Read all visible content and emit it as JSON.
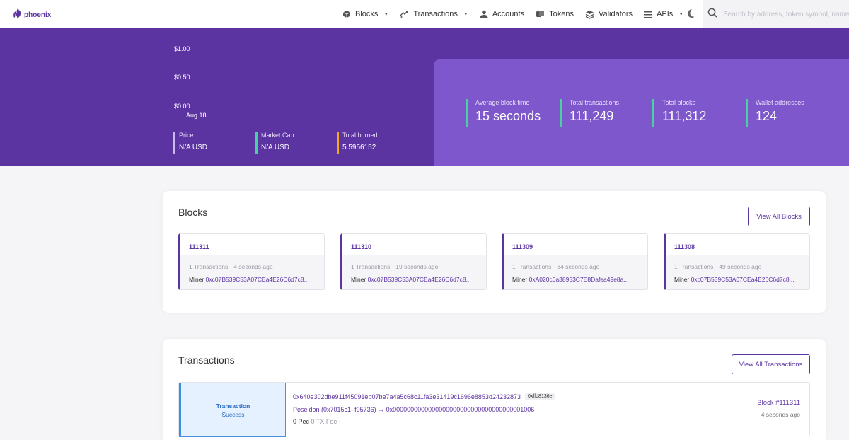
{
  "nav": {
    "logo_text": "phoenix",
    "items": [
      {
        "label": "Blocks",
        "icon": "cube-icon",
        "dropdown": true
      },
      {
        "label": "Transactions",
        "icon": "transfer-icon",
        "dropdown": true
      },
      {
        "label": "Accounts",
        "icon": "user-icon",
        "dropdown": false
      },
      {
        "label": "Tokens",
        "icon": "coins-icon",
        "dropdown": false
      },
      {
        "label": "Validators",
        "icon": "layers-icon",
        "dropdown": false
      },
      {
        "label": "APIs",
        "icon": "menu-icon",
        "dropdown": true
      }
    ],
    "search_placeholder": "Search by address, token symbol, name"
  },
  "hero": {
    "chart_ticks": [
      "$1.00",
      "$0.50",
      "$0.00"
    ],
    "chart_date": "Aug 18",
    "stats": [
      {
        "label": "Price",
        "value": "N/A USD"
      },
      {
        "label": "Market Cap",
        "value": "N/A USD"
      },
      {
        "label": "Total burned",
        "value": "5.5956152"
      }
    ],
    "panel_stats": [
      {
        "label": "Average block time",
        "value": "15 seconds"
      },
      {
        "label": "Total transactions",
        "value": "111,249"
      },
      {
        "label": "Total blocks",
        "value": "111,312"
      },
      {
        "label": "Wallet addresses",
        "value": "124"
      }
    ]
  },
  "blocks": {
    "title": "Blocks",
    "view_all": "View All Blocks",
    "items": [
      {
        "number": "111311",
        "tx_count": "1 Transactions",
        "age": "4 seconds ago",
        "miner_label": "Miner",
        "miner": "0xc07B539C53A07CEa4E26C6d7c8..."
      },
      {
        "number": "111310",
        "tx_count": "1 Transactions",
        "age": "19 seconds ago",
        "miner_label": "Miner",
        "miner": "0xc07B539C53A07CEa4E26C6d7c8..."
      },
      {
        "number": "111309",
        "tx_count": "1 Transactions",
        "age": "34 seconds ago",
        "miner_label": "Miner",
        "miner": "0xA020c0a38953C7E8Dafea49e8a..."
      },
      {
        "number": "111308",
        "tx_count": "1 Transactions",
        "age": "49 seconds ago",
        "miner_label": "Miner",
        "miner": "0xc07B539C53A07CEa4E26C6d7c8..."
      }
    ]
  },
  "transactions": {
    "title": "Transactions",
    "view_all": "View All Transactions",
    "items": [
      {
        "type": "Transaction",
        "status": "Success",
        "hash": "0x640e302dbe911f45091eb07be7a4a5c68c11fa3e31419c1696e8853d24232873",
        "method": "0xffd8136e",
        "route": "Poseidon (0x7015c1–f95736) → 0x0000000000000000000000000000000000001006",
        "value": "0 Pec",
        "fee": "0 TX Fee",
        "block": "Block #111311",
        "age": "4 seconds ago"
      }
    ]
  },
  "colors": {
    "brand": "#5c34a2",
    "panel": "#7e57cd",
    "stat_price": "#c9b8f0",
    "stat_market": "#48d0a3",
    "stat_burned": "#f5a623",
    "success": "#3b8ee8"
  }
}
